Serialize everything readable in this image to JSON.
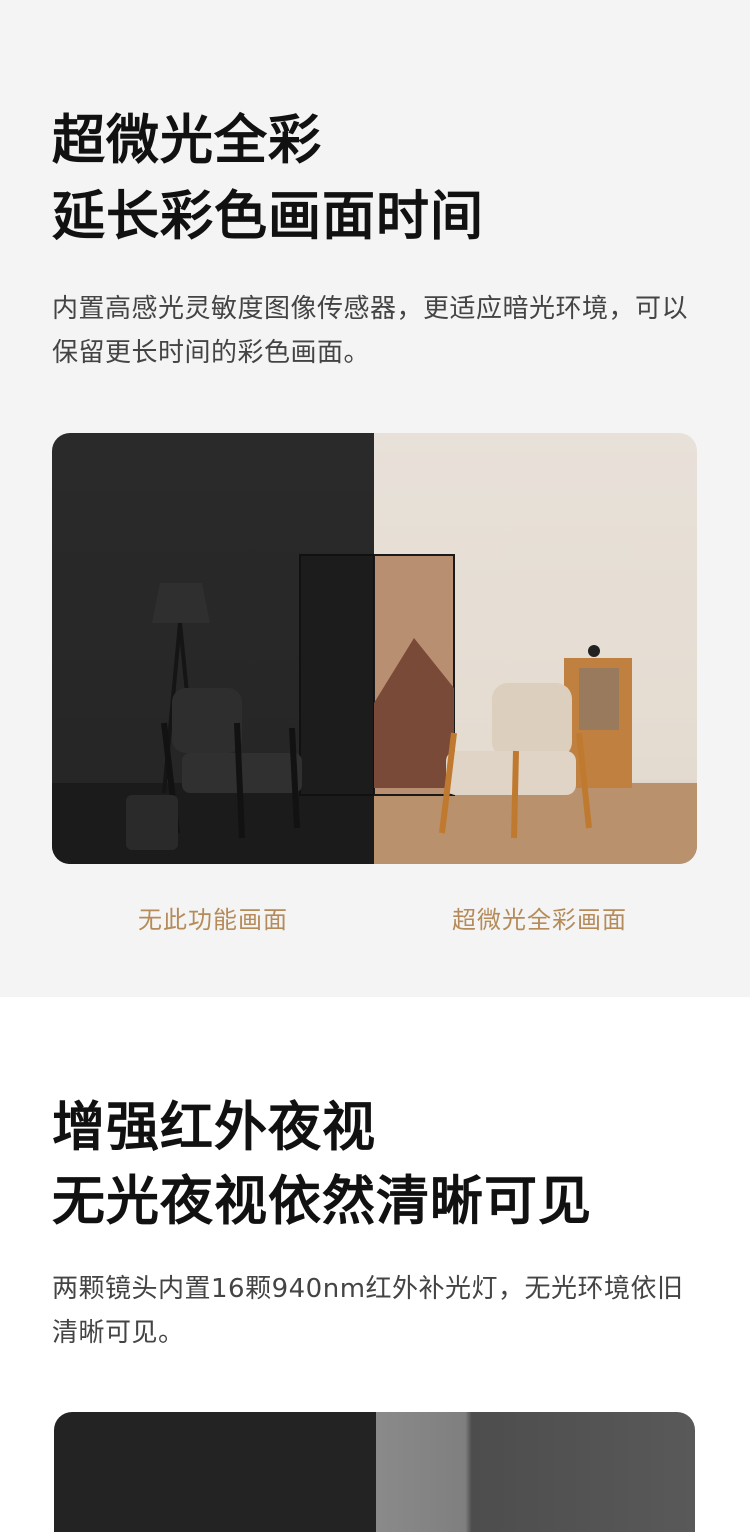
{
  "section_low_light": {
    "title_line1": "超微光全彩",
    "title_line2": "延长彩色画面时间",
    "description": "内置高感光灵敏度图像传感器，更适应暗光环境，可以保留更长时间的彩色画面。",
    "caption_without": "无此功能画面",
    "caption_with": "超微光全彩画面",
    "caption_color": "#b58b5a"
  },
  "section_night_vision": {
    "title_line1": "增强红外夜视",
    "title_line2": "无光夜视依然清晰可见",
    "description": "两颗镜头内置16颗940nm红外补光灯，无光环境依旧清晰可见。"
  },
  "icons": {
    "room_scene": "photo-comparison",
    "night_scene": "photo-comparison"
  }
}
